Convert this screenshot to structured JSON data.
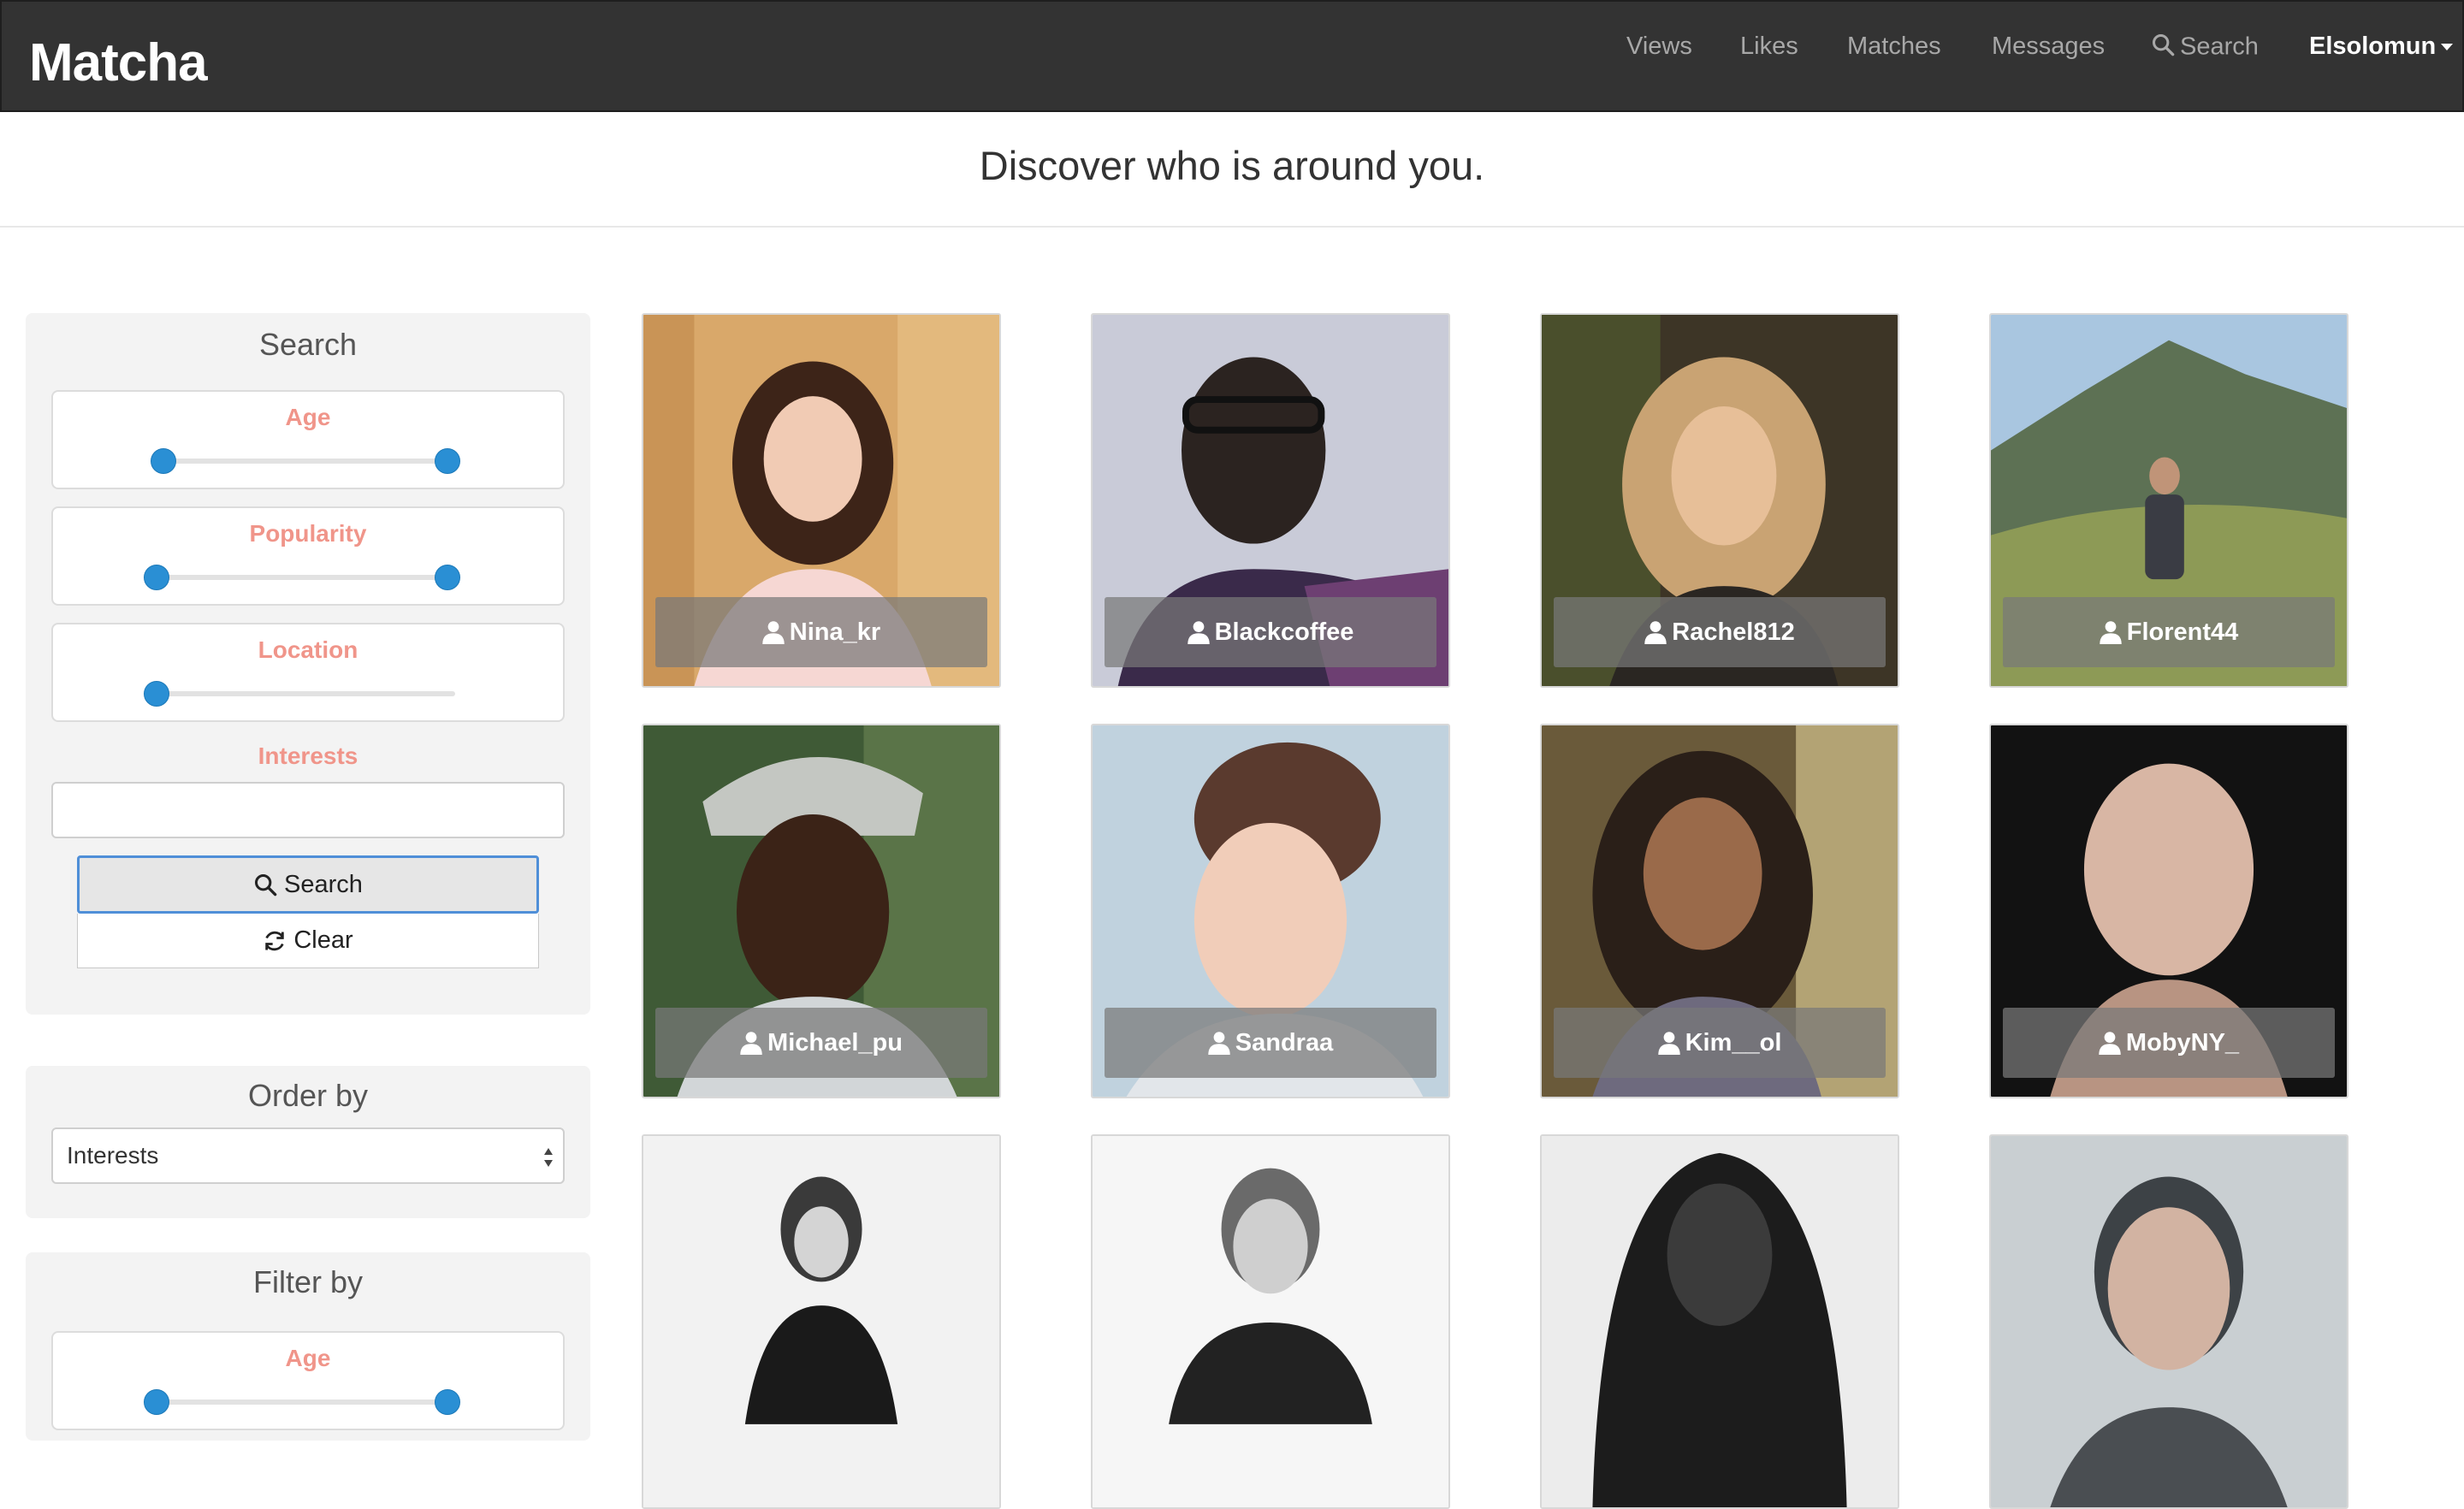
{
  "app": {
    "brand": "Matcha"
  },
  "nav": {
    "views": "Views",
    "likes": "Likes",
    "matches": "Matches",
    "messages": "Messages",
    "search": "Search",
    "user": "Elsolomun"
  },
  "heading": "Discover who is around you.",
  "search_panel": {
    "title": "Search",
    "age_label": "Age",
    "popularity_label": "Popularity",
    "location_label": "Location",
    "interests_label": "Interests",
    "interests_value": "",
    "search_button": "Search",
    "clear_button": "Clear"
  },
  "order_panel": {
    "title": "Order by",
    "selected": "Interests"
  },
  "filter_panel": {
    "title": "Filter by",
    "age_label": "Age"
  },
  "profiles": [
    {
      "username": "Nina_kr"
    },
    {
      "username": "Blackcoffee"
    },
    {
      "username": "Rachel812"
    },
    {
      "username": "Florent44"
    },
    {
      "username": "Michael_pu"
    },
    {
      "username": "Sandraa"
    },
    {
      "username": "Kim__ol"
    },
    {
      "username": "MobyNY_"
    },
    {
      "username": ""
    },
    {
      "username": ""
    },
    {
      "username": ""
    },
    {
      "username": ""
    }
  ],
  "icons": {
    "search": "search-icon",
    "user": "user-icon",
    "refresh": "refresh-icon",
    "caret": "caret-down-icon"
  },
  "colors": {
    "navbar": "#333333",
    "slider_label": "#f0958a",
    "slider_handle": "#2a8fd4",
    "focus_border": "#4f8fd8"
  }
}
